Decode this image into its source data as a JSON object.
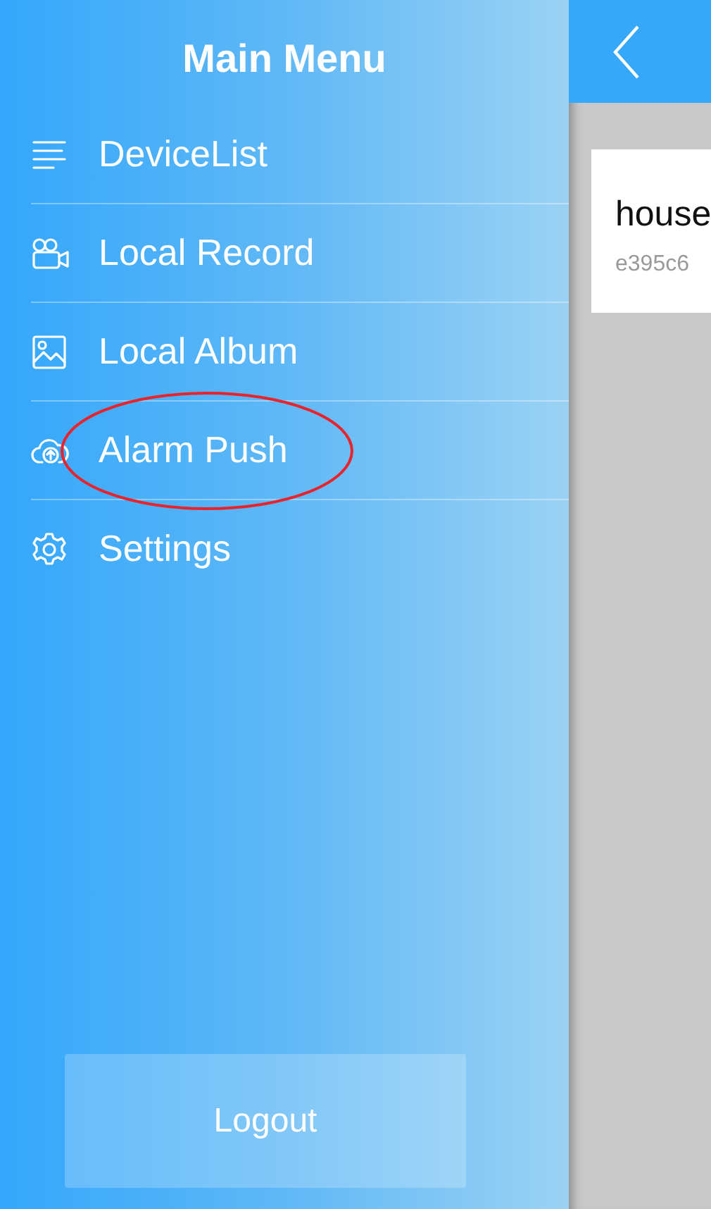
{
  "sidebar": {
    "title": "Main Menu",
    "items": [
      {
        "kind": "list",
        "label": "DeviceList",
        "circled": false
      },
      {
        "kind": "record",
        "label": "Local Record",
        "circled": false
      },
      {
        "kind": "album",
        "label": "Local Album",
        "circled": false
      },
      {
        "kind": "cloud",
        "label": "Alarm Push",
        "circled": true
      },
      {
        "kind": "settings",
        "label": "Settings",
        "circled": false
      }
    ],
    "logout_button": "Logout"
  },
  "main": {
    "device_card": {
      "name": "house",
      "id": "e395c6"
    }
  }
}
